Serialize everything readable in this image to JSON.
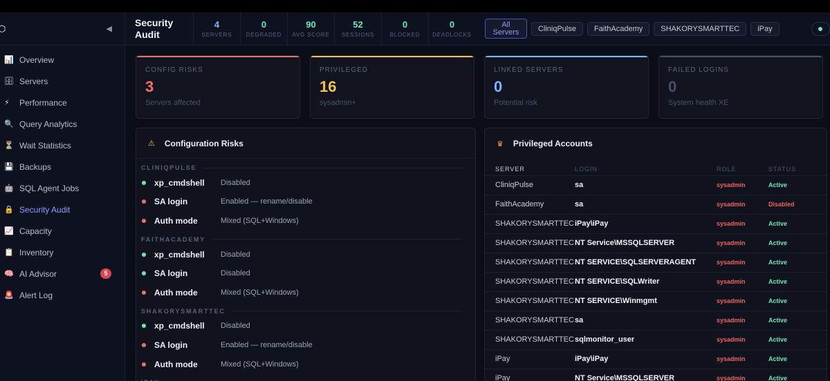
{
  "sidebar": {
    "items": [
      {
        "icon": "📊",
        "label": "Overview",
        "name": "overview"
      },
      {
        "icon": "🗄",
        "label": "Servers",
        "name": "servers"
      },
      {
        "icon": "⚡",
        "label": "Performance",
        "name": "performance"
      },
      {
        "icon": "🔍",
        "label": "Query Analytics",
        "name": "query-analytics"
      },
      {
        "icon": "⏳",
        "label": "Wait Statistics",
        "name": "wait-statistics"
      },
      {
        "icon": "💾",
        "label": "Backups",
        "name": "backups"
      },
      {
        "icon": "🤖",
        "label": "SQL Agent Jobs",
        "name": "sql-agent-jobs"
      },
      {
        "icon": "🔒",
        "label": "Security Audit",
        "name": "security-audit",
        "active": true
      },
      {
        "icon": "📈",
        "label": "Capacity",
        "name": "capacity"
      },
      {
        "icon": "📋",
        "label": "Inventory",
        "name": "inventory"
      },
      {
        "icon": "🧠",
        "label": "AI Advisor",
        "name": "ai-advisor",
        "badge": "5"
      },
      {
        "icon": "🚨",
        "label": "Alert Log",
        "name": "alert-log"
      }
    ]
  },
  "header": {
    "title": "Security Audit",
    "stats": [
      {
        "value": "4",
        "label": "SERVERS",
        "color": "blue"
      },
      {
        "value": "0",
        "label": "DEGRADED",
        "color": "green"
      },
      {
        "value": "90",
        "label": "AVG SCORE",
        "color": "green"
      },
      {
        "value": "52",
        "label": "SESSIONS",
        "color": "green"
      },
      {
        "value": "0",
        "label": "BLOCKED",
        "color": "green"
      },
      {
        "value": "0",
        "label": "DEADLOCKS",
        "color": "green"
      }
    ],
    "filters": {
      "all": "All Servers",
      "servers": [
        "CliniqPulse",
        "FaithAcademy",
        "SHAKORYSMARTTEC",
        "iPay"
      ]
    }
  },
  "cards": [
    {
      "title": "CONFIG RISKS",
      "value": "3",
      "sub": "Servers affected",
      "color": "#f06f6a"
    },
    {
      "title": "PRIVILEGED",
      "value": "16",
      "sub": "sysadmin+",
      "color": "#f5c24b"
    },
    {
      "title": "LINKED SERVERS",
      "value": "0",
      "sub": "Potential risk",
      "color": "#7fb2ff"
    },
    {
      "title": "FAILED LOGINS",
      "value": "0",
      "sub": "System health XE",
      "color": "#4b5068"
    }
  ],
  "config_risks": {
    "title": "Configuration Risks",
    "groups": [
      {
        "server": "CLINIQPULSE",
        "rows": [
          {
            "key": "xp_cmdshell",
            "value": "Disabled",
            "ok": true
          },
          {
            "key": "SA login",
            "value": "Enabled — rename/disable",
            "ok": false
          },
          {
            "key": "Auth mode",
            "value": "Mixed (SQL+Windows)",
            "ok": false
          }
        ]
      },
      {
        "server": "FAITHACADEMY",
        "rows": [
          {
            "key": "xp_cmdshell",
            "value": "Disabled",
            "ok": true
          },
          {
            "key": "SA login",
            "value": "Disabled",
            "ok": true
          },
          {
            "key": "Auth mode",
            "value": "Mixed (SQL+Windows)",
            "ok": false
          }
        ]
      },
      {
        "server": "SHAKORYSMARTTEC",
        "rows": [
          {
            "key": "xp_cmdshell",
            "value": "Disabled",
            "ok": true
          },
          {
            "key": "SA login",
            "value": "Enabled — rename/disable",
            "ok": false
          },
          {
            "key": "Auth mode",
            "value": "Mixed (SQL+Windows)",
            "ok": false
          }
        ]
      },
      {
        "server": "IPAY",
        "rows": []
      }
    ]
  },
  "privileged": {
    "title": "Privileged Accounts",
    "columns": [
      "SERVER",
      "LOGIN",
      "ROLE",
      "STATUS"
    ],
    "rows": [
      {
        "server": "CliniqPulse",
        "login": "sa",
        "role": "sysadmin",
        "status": "Active"
      },
      {
        "server": "FaithAcademy",
        "login": "sa",
        "role": "sysadmin",
        "status": "Disabled"
      },
      {
        "server": "SHAKORYSMARTTEC",
        "login": "iPay\\iPay",
        "role": "sysadmin",
        "status": "Active"
      },
      {
        "server": "SHAKORYSMARTTEC",
        "login": "NT Service\\MSSQLSERVER",
        "role": "sysadmin",
        "status": "Active"
      },
      {
        "server": "SHAKORYSMARTTEC",
        "login": "NT SERVICE\\SQLSERVERAGENT",
        "role": "sysadmin",
        "status": "Active"
      },
      {
        "server": "SHAKORYSMARTTEC",
        "login": "NT SERVICE\\SQLWriter",
        "role": "sysadmin",
        "status": "Active"
      },
      {
        "server": "SHAKORYSMARTTEC",
        "login": "NT SERVICE\\Winmgmt",
        "role": "sysadmin",
        "status": "Active"
      },
      {
        "server": "SHAKORYSMARTTEC",
        "login": "sa",
        "role": "sysadmin",
        "status": "Active"
      },
      {
        "server": "SHAKORYSMARTTEC",
        "login": "sqlmonitor_user",
        "role": "sysadmin",
        "status": "Active"
      },
      {
        "server": "iPay",
        "login": "iPay\\iPay",
        "role": "sysadmin",
        "status": "Active"
      },
      {
        "server": "iPay",
        "login": "NT Service\\MSSQLSERVER",
        "role": "sysadmin",
        "status": "Active"
      }
    ]
  }
}
